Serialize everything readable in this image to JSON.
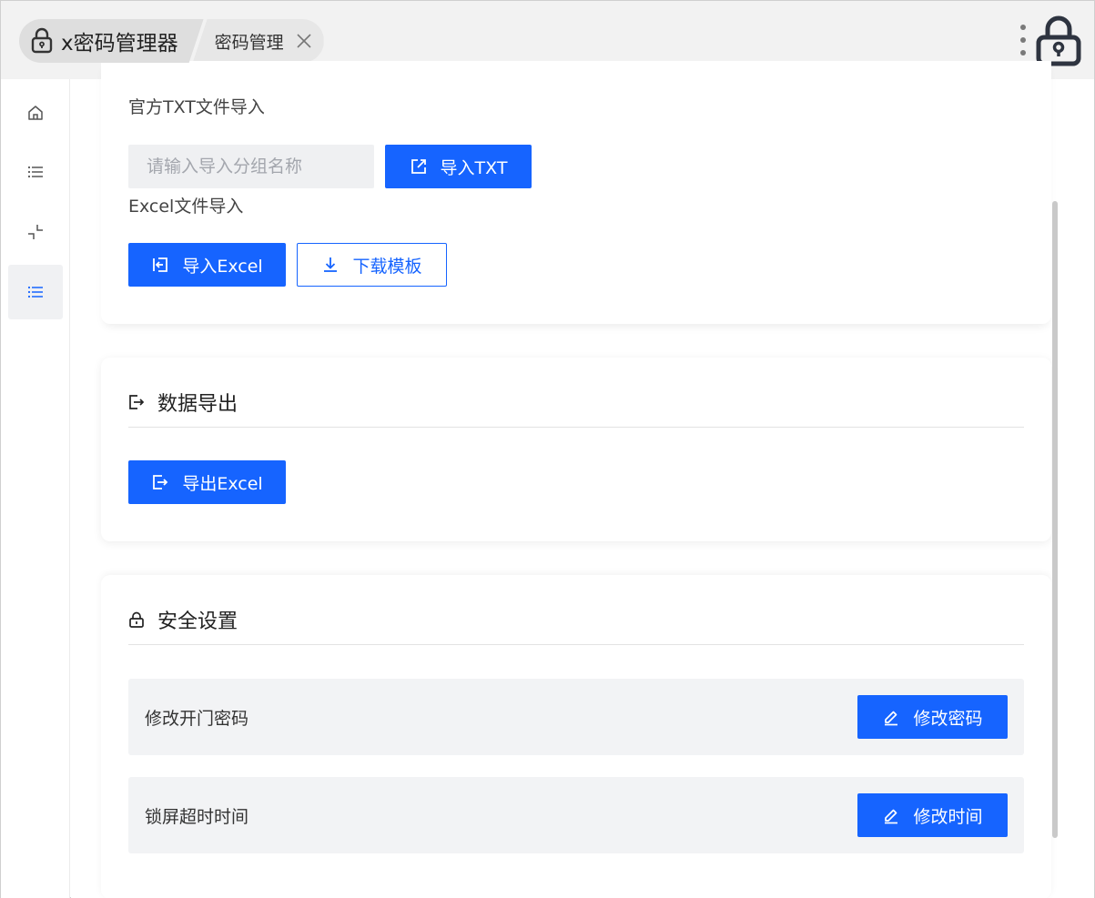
{
  "app": {
    "title": "x密码管理器"
  },
  "tabs": [
    {
      "label": "密码管理"
    }
  ],
  "sidebar": {
    "items": [
      {
        "icon": "home-icon"
      },
      {
        "icon": "list-icon"
      },
      {
        "icon": "collapse-icon"
      },
      {
        "icon": "list-icon",
        "active": true
      }
    ]
  },
  "import": {
    "txt_label": "官方TXT文件导入",
    "group_placeholder": "请输入导入分组名称",
    "txt_button": "导入TXT",
    "excel_label": "Excel文件导入",
    "excel_button": "导入Excel",
    "template_button": "下载模板"
  },
  "export": {
    "title": "数据导出",
    "excel_button": "导出Excel"
  },
  "security": {
    "title": "安全设置",
    "rows": [
      {
        "label": "修改开门密码",
        "button": "修改密码"
      },
      {
        "label": "锁屏超时时间",
        "button": "修改时间"
      }
    ]
  },
  "colors": {
    "primary": "#1664ff",
    "topbar": "#f2f2f2",
    "row_bg": "#f2f3f5"
  }
}
